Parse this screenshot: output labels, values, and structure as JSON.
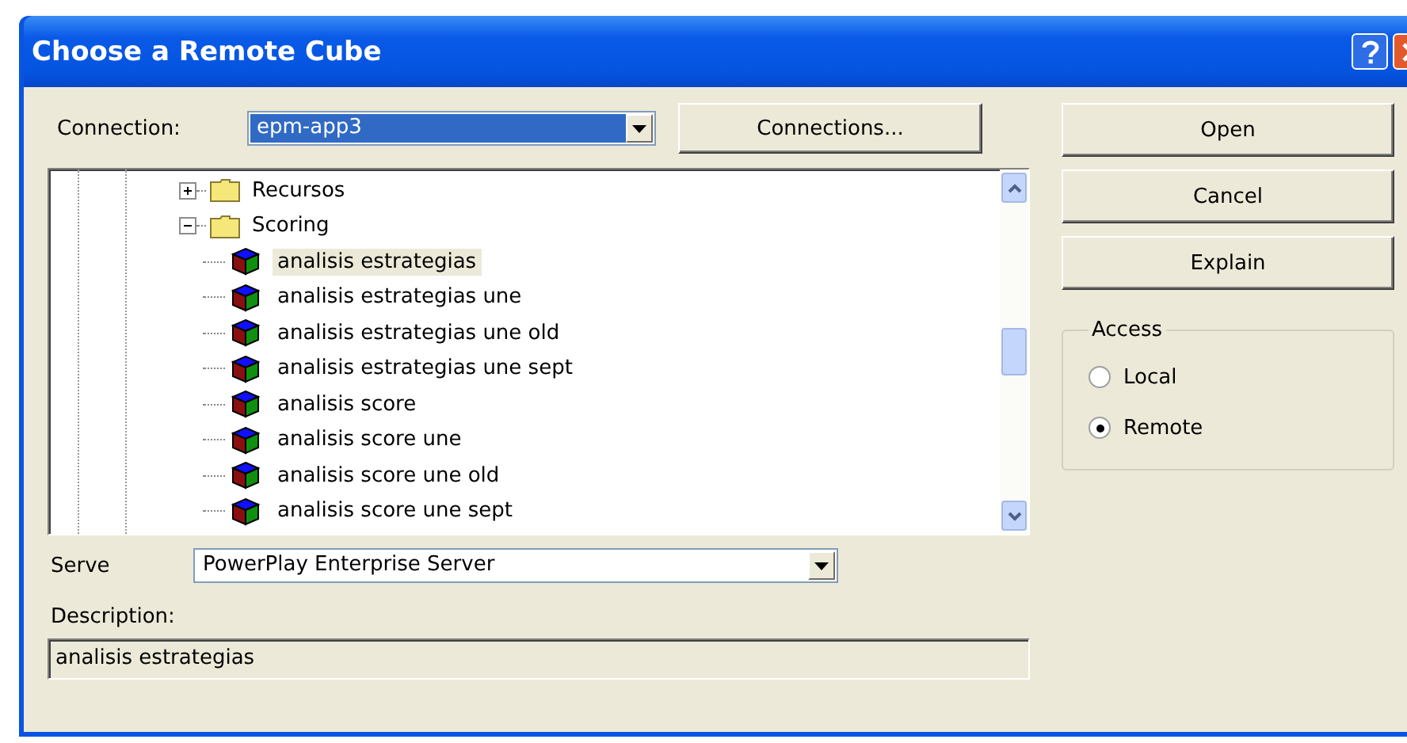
{
  "window": {
    "title": "Choose a Remote Cube"
  },
  "connection": {
    "label": "Connection:",
    "value": "epm-app3",
    "selected": true
  },
  "connections_button": "Connections...",
  "tree": [
    {
      "label": "Recursos",
      "kind": "folder",
      "expanded": false,
      "selected": false
    },
    {
      "label": "Scoring",
      "kind": "folder",
      "expanded": true,
      "selected": false,
      "children": [
        {
          "label": "analisis estrategias",
          "kind": "cube",
          "selected": true
        },
        {
          "label": "analisis estrategias une",
          "kind": "cube",
          "selected": false
        },
        {
          "label": "analisis estrategias une old",
          "kind": "cube",
          "selected": false
        },
        {
          "label": "analisis estrategias une sept",
          "kind": "cube",
          "selected": false
        },
        {
          "label": "analisis score",
          "kind": "cube",
          "selected": false
        },
        {
          "label": "analisis score une",
          "kind": "cube",
          "selected": false
        },
        {
          "label": "analisis score une old",
          "kind": "cube",
          "selected": false
        },
        {
          "label": "analisis score une sept",
          "kind": "cube",
          "selected": false
        }
      ]
    }
  ],
  "server": {
    "label": "Serve",
    "value": "PowerPlay Enterprise Server"
  },
  "description": {
    "label": "Description:",
    "value": "analisis estrategias"
  },
  "buttons": [
    "Open",
    "Cancel",
    "Explain"
  ],
  "access": {
    "title": "Access",
    "options": [
      {
        "label": "Local",
        "selected": false
      },
      {
        "label": "Remote",
        "selected": true
      }
    ]
  }
}
